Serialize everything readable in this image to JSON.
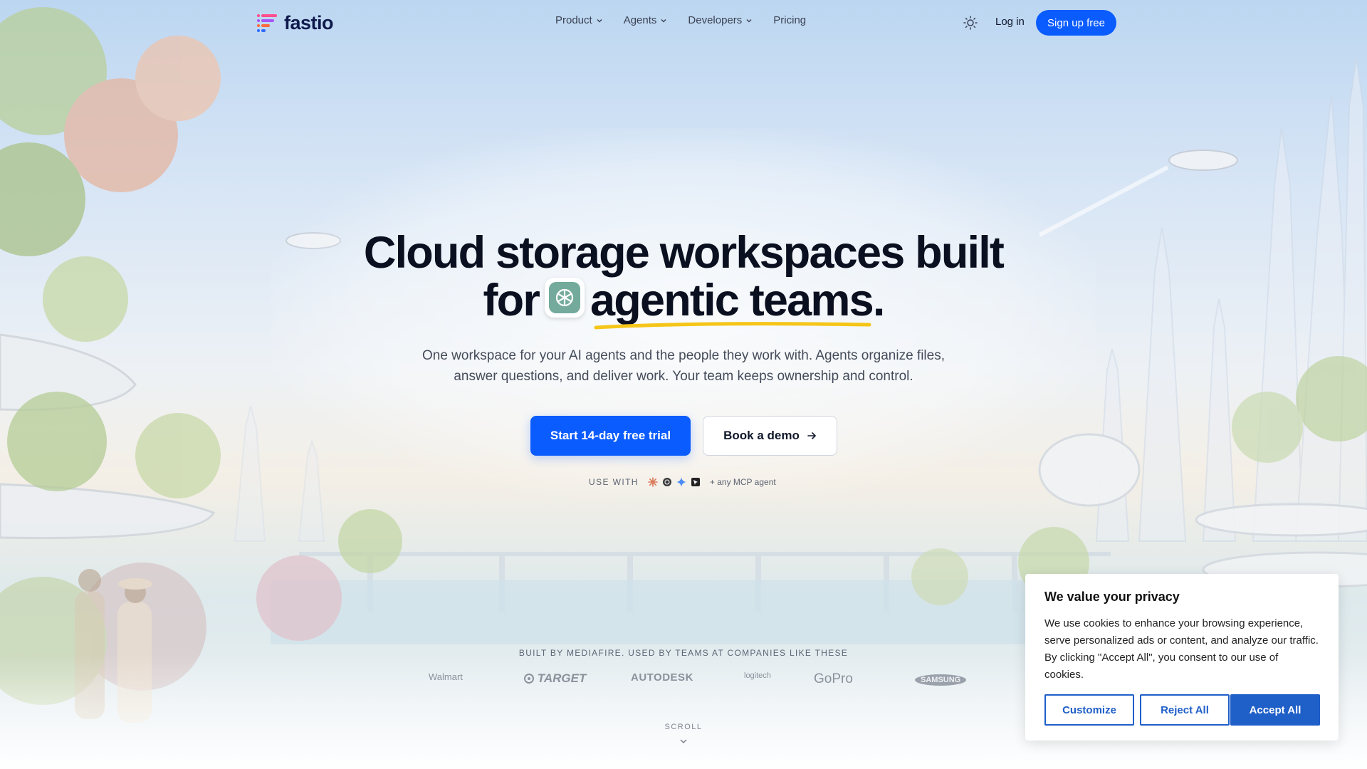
{
  "header": {
    "logo_text": "fastio",
    "nav": [
      {
        "label": "Product",
        "has_dropdown": true
      },
      {
        "label": "Agents",
        "has_dropdown": true
      },
      {
        "label": "Developers",
        "has_dropdown": true
      },
      {
        "label": "Pricing",
        "has_dropdown": false
      }
    ],
    "theme_icon": "sun-icon",
    "login_label": "Log in",
    "signup_label": "Sign up free"
  },
  "hero": {
    "title_line1": "Cloud storage workspaces built",
    "title_for": "for",
    "title_highlight": "agentic teams",
    "title_period": ".",
    "inline_icon": "openai-logo-icon",
    "subtitle": "One workspace for your AI agents and the people they work with. Agents organize files, answer questions, and deliver work. Your team keeps ownership and control.",
    "primary_cta": "Start 14-day free trial",
    "secondary_cta": "Book a demo",
    "use_with_label": "USE WITH",
    "use_with_icons": [
      "claude-icon",
      "openai-icon",
      "gemini-icon",
      "cursor-icon"
    ],
    "use_with_suffix": "+ any MCP agent"
  },
  "companies": {
    "label": "BUILT BY MEDIAFIRE. USED BY TEAMS AT COMPANIES LIKE THESE",
    "names": [
      "Walmart",
      "TARGET",
      "AUTODESK",
      "logitech",
      "GoPro",
      "SAMSUNG"
    ]
  },
  "scroll_label": "SCROLL",
  "cookie": {
    "title": "We value your privacy",
    "text": "We use cookies to enhance your browsing experience, serve personalized ads or content, and analyze our traffic. By clicking \"Accept All\", you consent to our use of cookies.",
    "customize_label": "Customize",
    "reject_label": "Reject All",
    "accept_label": "Accept All"
  },
  "colors": {
    "primary": "#0a5cff",
    "cookie_accent": "#1f5fc8",
    "highlight_underline": "#f5c518",
    "title": "#0b1020"
  }
}
